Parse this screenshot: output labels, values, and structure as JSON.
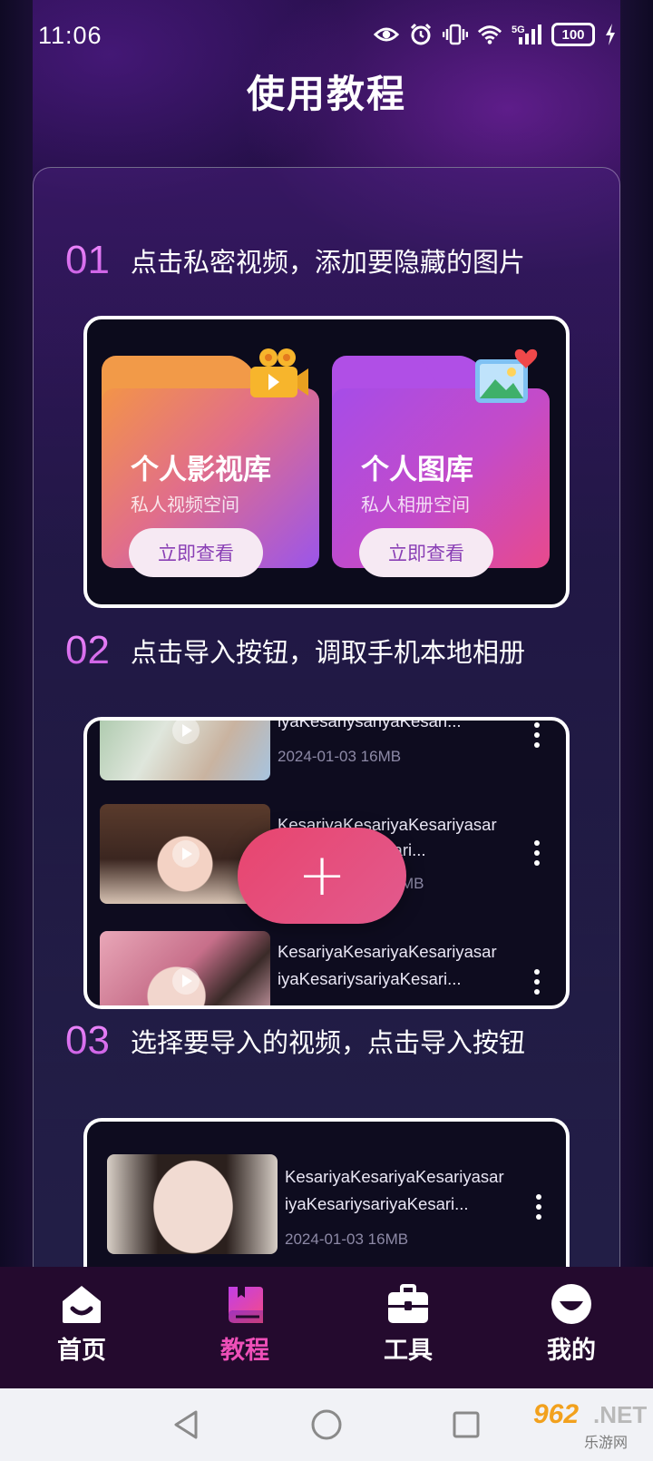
{
  "status_bar": {
    "time": "11:06",
    "network": "5G",
    "battery": "100",
    "icons": [
      "eye-icon",
      "alarm-icon",
      "vibrate-icon",
      "wifi-icon",
      "signal-5g-icon",
      "battery-icon",
      "charging-bolt-icon"
    ]
  },
  "page_title": "使用教程",
  "steps": [
    {
      "num": "01",
      "text": "点击私密视频，添加要隐藏的图片",
      "folders": [
        {
          "title": "个人影视库",
          "subtitle": "私人视频空间",
          "button": "立即查看",
          "icon": "movie-camera-icon"
        },
        {
          "title": "个人图库",
          "subtitle": "私人相册空间",
          "button": "立即查看",
          "icon": "photo-heart-icon"
        }
      ]
    },
    {
      "num": "02",
      "text": "点击导入按钮，调取手机本地相册",
      "rows": [
        {
          "title_line2": "iyaKesariysariyaKesari...",
          "meta": "2024-01-03 16MB"
        },
        {
          "title_line1": "KesariyaKesariyaKesariyasar",
          "title_line2": "iyaKesari...",
          "meta": "MB"
        },
        {
          "title_line1": "KesariyaKesariyaKesariyasar",
          "title_line2": "iyaKesariysariyaKesari..."
        }
      ],
      "fab_label": "+"
    },
    {
      "num": "03",
      "text": "选择要导入的视频，点击导入按钮",
      "rows": [
        {
          "title_line1": "KesariyaKesariyaKesariyasar",
          "title_line2": "iyaKesariysariyaKesari...",
          "meta": "2024-01-03 16MB"
        }
      ]
    }
  ],
  "bottom_nav": [
    {
      "label": "首页",
      "icon": "home-icon",
      "active": false
    },
    {
      "label": "教程",
      "icon": "tutorial-book-icon",
      "active": true
    },
    {
      "label": "工具",
      "icon": "toolbox-icon",
      "active": false
    },
    {
      "label": "我的",
      "icon": "profile-icon",
      "active": false
    }
  ],
  "watermark": {
    "brand": "962",
    "suffix": ".NET",
    "sub": "乐游网"
  },
  "colors": {
    "accent": "#ee4fb8",
    "step_number": "#d86bef",
    "fab": "#e8456e",
    "nav_bg": "#240a2e"
  }
}
